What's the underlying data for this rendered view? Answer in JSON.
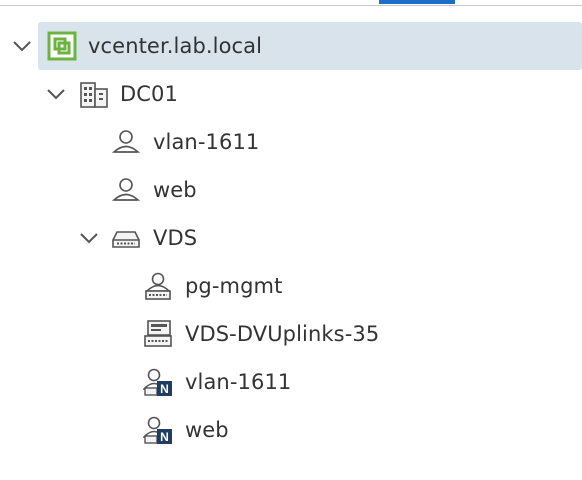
{
  "tree": {
    "vcenter": {
      "label": "vcenter.lab.local",
      "icon": "vcenter-icon",
      "expanded": true,
      "selected": true
    },
    "datacenter": {
      "label": "DC01",
      "icon": "datacenter-icon",
      "expanded": true
    },
    "networks": [
      {
        "label": "vlan-1611",
        "icon": "network-icon"
      },
      {
        "label": "web",
        "icon": "network-icon"
      }
    ],
    "switch": {
      "label": "VDS",
      "icon": "distributed-switch-icon",
      "expanded": true
    },
    "portgroups": [
      {
        "label": "pg-mgmt",
        "icon": "portgroup-icon"
      },
      {
        "label": "VDS-DVUplinks-35",
        "icon": "uplink-portgroup-icon"
      },
      {
        "label": "vlan-1611",
        "icon": "nsx-segment-icon"
      },
      {
        "label": "web",
        "icon": "nsx-segment-icon"
      }
    ]
  },
  "colors": {
    "selection": "#d9e3ec",
    "tab_accent": "#1c6ec6",
    "vcenter_green": "#6db33f",
    "text": "#333333"
  }
}
